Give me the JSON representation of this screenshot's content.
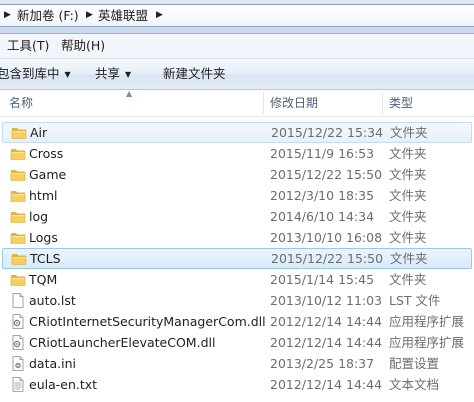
{
  "address": {
    "crumbs": [
      "新加卷 (F:)",
      "英雄联盟"
    ]
  },
  "menu": {
    "tools": "工具(T)",
    "help": "帮助(H)"
  },
  "toolbar": {
    "include_library": "包含到库中",
    "share": "共享",
    "new_folder": "新建文件夹"
  },
  "columns": {
    "name": "名称",
    "modified": "修改日期",
    "type": "类型"
  },
  "files": [
    {
      "name": "Air",
      "modified": "2015/12/22 15:34",
      "type": "文件夹",
      "icon": "folder-icon",
      "state": "hover"
    },
    {
      "name": "Cross",
      "modified": "2015/11/9 16:53",
      "type": "文件夹",
      "icon": "folder-icon",
      "state": ""
    },
    {
      "name": "Game",
      "modified": "2015/12/22 15:50",
      "type": "文件夹",
      "icon": "folder-icon",
      "state": ""
    },
    {
      "name": "html",
      "modified": "2012/3/10 18:35",
      "type": "文件夹",
      "icon": "folder-icon",
      "state": ""
    },
    {
      "name": "log",
      "modified": "2014/6/10 14:34",
      "type": "文件夹",
      "icon": "folder-icon",
      "state": ""
    },
    {
      "name": "Logs",
      "modified": "2013/10/10 16:08",
      "type": "文件夹",
      "icon": "folder-icon",
      "state": ""
    },
    {
      "name": "TCLS",
      "modified": "2015/12/22 15:50",
      "type": "文件夹",
      "icon": "folder-icon",
      "state": "selected"
    },
    {
      "name": "TQM",
      "modified": "2015/1/14 15:45",
      "type": "文件夹",
      "icon": "folder-icon",
      "state": ""
    },
    {
      "name": "auto.lst",
      "modified": "2013/10/12 11:03",
      "type": "LST 文件",
      "icon": "document-icon",
      "state": ""
    },
    {
      "name": "CRiotInternetSecurityManagerCom.dll",
      "modified": "2012/12/14 14:44",
      "type": "应用程序扩展",
      "icon": "dll-icon",
      "state": ""
    },
    {
      "name": "CRiotLauncherElevateCOM.dll",
      "modified": "2012/12/14 14:44",
      "type": "应用程序扩展",
      "icon": "dll-icon",
      "state": ""
    },
    {
      "name": "data.ini",
      "modified": "2013/2/25 18:37",
      "type": "配置设置",
      "icon": "settings-file-icon",
      "state": ""
    },
    {
      "name": "eula-en.txt",
      "modified": "2012/12/14 14:44",
      "type": "文本文档",
      "icon": "text-file-icon",
      "state": ""
    }
  ]
}
